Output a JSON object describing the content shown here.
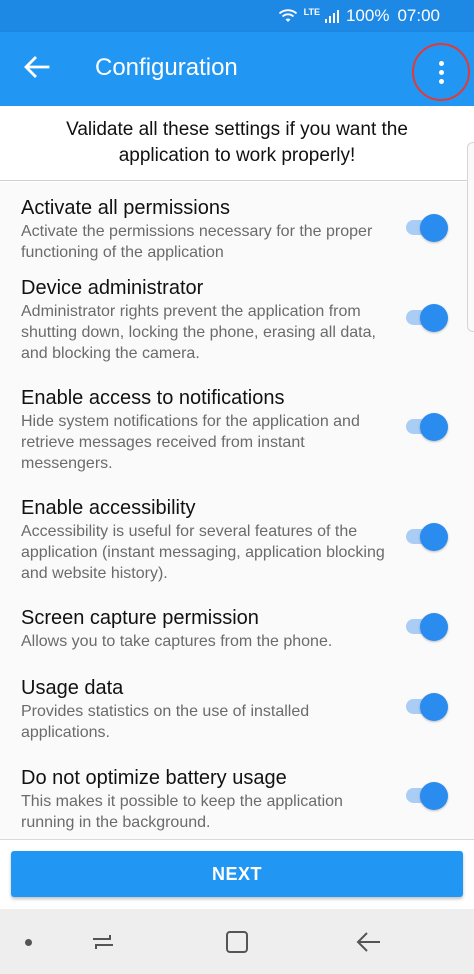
{
  "status_bar": {
    "network": "LTE",
    "battery": "100%",
    "time": "07:00",
    "icons": [
      "wifi-icon",
      "signal-icon"
    ]
  },
  "app_bar": {
    "title": "Configuration",
    "back_icon": "arrow-left-icon",
    "menu_icon": "more-vert-icon"
  },
  "intro": "Validate all these settings if you want the application to work properly!",
  "settings": [
    {
      "title": "Activate all permissions",
      "description": "Activate the permissions necessary for the proper functioning of the application",
      "enabled": true
    },
    {
      "title": "Device administrator",
      "description": "Administrator rights prevent the application from shutting down, locking the phone, erasing all data, and blocking the camera.",
      "enabled": true
    },
    {
      "title": "Enable access to notifications",
      "description": "Hide system notifications for the application and retrieve messages received from instant messengers.",
      "enabled": true
    },
    {
      "title": "Enable accessibility",
      "description": "Accessibility is useful for several features of the application (instant messaging, application blocking and website history).",
      "enabled": true
    },
    {
      "title": "Screen capture permission",
      "description": "Allows you to take captures from the phone.",
      "enabled": true
    },
    {
      "title": "Usage data",
      "description": "Provides statistics on the use of installed applications.",
      "enabled": true
    },
    {
      "title": "Do not optimize battery usage",
      "description": "This makes it possible to keep the application running in the background.",
      "enabled": true
    }
  ],
  "next_button": "NEXT",
  "nav_bar": {
    "icons": [
      "nav-dot-icon",
      "recents-icon",
      "home-icon",
      "back-icon"
    ]
  },
  "colors": {
    "primary": "#2196f3",
    "status_bar": "#1e88e5",
    "toggle_on": "#2b8cef",
    "toggle_track": "#a9cdf5",
    "highlight_circle": "#e53935"
  }
}
